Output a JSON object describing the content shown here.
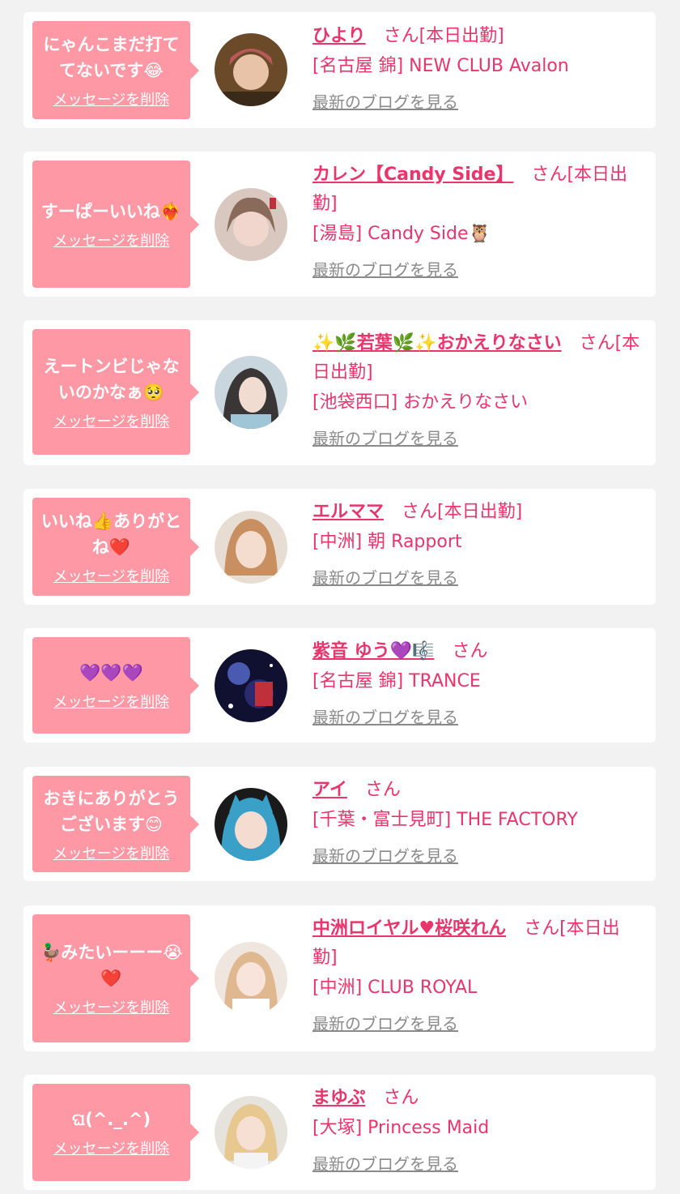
{
  "colors": {
    "accent": "#e8356b",
    "bubble": "#fe98a4",
    "background": "#f2f2f2",
    "link_gray": "#8a8a8a"
  },
  "items": [
    {
      "message": "にゃんこまだ打ててないです😂",
      "delete_label": "メッセージを削除",
      "name": "ひより",
      "suffix": "さん[本日出勤]",
      "store": "[名古屋 錦] NEW CLUB Avalon",
      "blog_label": "最新のブログを見る"
    },
    {
      "message": "すーぱーいいね❤️‍🔥",
      "delete_label": "メッセージを削除",
      "name": "カレン【Candy Side】",
      "suffix": "さん[本日出勤]",
      "store": "[湯島] Candy Side🦉",
      "blog_label": "最新のブログを見る"
    },
    {
      "message": "えートンビじゃないのかなぁ🥺",
      "delete_label": "メッセージを削除",
      "name": "✨🌿若葉🌿✨おかえりなさい",
      "suffix": "さん[本日出勤]",
      "store": "[池袋西口] おかえりなさい",
      "blog_label": "最新のブログを見る"
    },
    {
      "message": "いいね👍ありがとね❤️",
      "delete_label": "メッセージを削除",
      "name": "エルママ",
      "suffix": "さん[本日出勤]",
      "store": "[中洲] 朝 Rapport",
      "blog_label": "最新のブログを見る"
    },
    {
      "message": "💜💜💜",
      "delete_label": "メッセージを削除",
      "name": "紫音 ゆう💜🎼",
      "suffix": "さん",
      "store": "[名古屋 錦] TRANCE",
      "blog_label": "最新のブログを見る"
    },
    {
      "message": "おきにありがとうございます😊",
      "delete_label": "メッセージを削除",
      "name": "アイ",
      "suffix": "さん",
      "store": "[千葉・富士見町] THE FACTORY",
      "blog_label": "最新のブログを見る"
    },
    {
      "message": "🦆みたいーーー😭❤️",
      "delete_label": "メッセージを削除",
      "name": "中洲ロイヤル♥桜咲れん",
      "suffix": "さん[本日出勤]",
      "store": "[中洲] CLUB ROYAL",
      "blog_label": "最新のブログを見る"
    },
    {
      "message": "ଘ(^._.^)",
      "delete_label": "メッセージを削除",
      "name": "まゆぷ",
      "suffix": "さん",
      "store": "[大塚] Princess Maid",
      "blog_label": "最新のブログを見る"
    }
  ]
}
